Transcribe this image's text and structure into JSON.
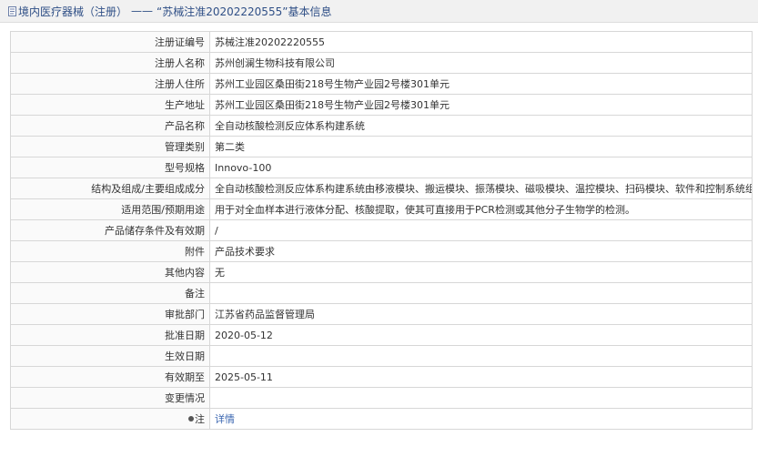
{
  "header": {
    "crumb": "境内医疗器械（注册）",
    "separator": "——",
    "reg_title": "“苏械注准20202220555”",
    "suffix": "基本信息"
  },
  "rows": [
    {
      "label": "注册证编号",
      "value": "苏械注准20202220555"
    },
    {
      "label": "注册人名称",
      "value": "苏州创澜生物科技有限公司"
    },
    {
      "label": "注册人住所",
      "value": "苏州工业园区桑田街218号生物产业园2号楼301单元"
    },
    {
      "label": "生产地址",
      "value": "苏州工业园区桑田街218号生物产业园2号楼301单元"
    },
    {
      "label": "产品名称",
      "value": "全自动核酸检测反应体系构建系统"
    },
    {
      "label": "管理类别",
      "value": "第二类"
    },
    {
      "label": "型号规格",
      "value": "Innovo-100"
    },
    {
      "label": "结构及组成/主要组成成分",
      "value": "全自动核酸检测反应体系构建系统由移液模块、搬运模块、振荡模块、磁吸模块、温控模块、扫码模块、软件和控制系统组成。"
    },
    {
      "label": "适用范围/预期用途",
      "value": "用于对全血样本进行液体分配、核酸提取，使其可直接用于PCR检测或其他分子生物学的检测。"
    },
    {
      "label": "产品储存条件及有效期",
      "value": "/"
    },
    {
      "label": "附件",
      "value": "产品技术要求"
    },
    {
      "label": "其他内容",
      "value": "无"
    },
    {
      "label": "备注",
      "value": ""
    },
    {
      "label": "审批部门",
      "value": "江苏省药品监督管理局"
    },
    {
      "label": "批准日期",
      "value": "2020-05-12"
    },
    {
      "label": "生效日期",
      "value": ""
    },
    {
      "label": "有效期至",
      "value": "2025-05-11"
    },
    {
      "label": "变更情况",
      "value": ""
    }
  ],
  "note_row": {
    "label": "注",
    "link_text": "详情"
  },
  "icons": {
    "header_icon": "document-icon",
    "note_icon": "bullet-icon"
  }
}
